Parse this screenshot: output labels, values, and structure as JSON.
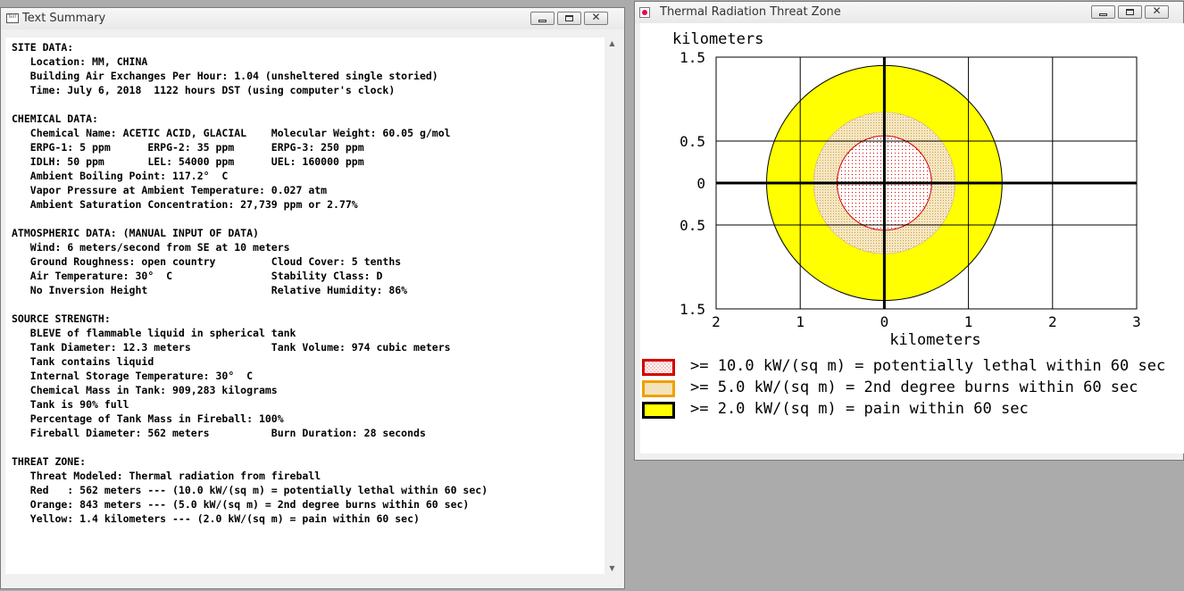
{
  "text_window": {
    "title": "Text Summary",
    "icon_text": "TEXT",
    "lines": [
      "SITE DATA:",
      "   Location: MM, CHINA",
      "   Building Air Exchanges Per Hour: 1.04 (unsheltered single storied)",
      "   Time: July 6, 2018  1122 hours DST (using computer's clock)",
      "",
      "CHEMICAL DATA:",
      "   Chemical Name: ACETIC ACID, GLACIAL    Molecular Weight: 60.05 g/mol",
      "   ERPG-1: 5 ppm      ERPG-2: 35 ppm      ERPG-3: 250 ppm",
      "   IDLH: 50 ppm       LEL: 54000 ppm      UEL: 160000 ppm",
      "   Ambient Boiling Point: 117.2°  C",
      "   Vapor Pressure at Ambient Temperature: 0.027 atm",
      "   Ambient Saturation Concentration: 27,739 ppm or 2.77%",
      "",
      "ATMOSPHERIC DATA: (MANUAL INPUT OF DATA)",
      "   Wind: 6 meters/second from SE at 10 meters",
      "   Ground Roughness: open country         Cloud Cover: 5 tenths",
      "   Air Temperature: 30°  C                Stability Class: D",
      "   No Inversion Height                    Relative Humidity: 86%",
      "",
      "SOURCE STRENGTH:",
      "   BLEVE of flammable liquid in spherical tank",
      "   Tank Diameter: 12.3 meters             Tank Volume: 974 cubic meters",
      "   Tank contains liquid",
      "   Internal Storage Temperature: 30°  C",
      "   Chemical Mass in Tank: 909,283 kilograms",
      "   Tank is 90% full",
      "   Percentage of Tank Mass in Fireball: 100%",
      "   Fireball Diameter: 562 meters          Burn Duration: 28 seconds",
      "",
      "THREAT ZONE:",
      "   Threat Modeled: Thermal radiation from fireball",
      "   Red   : 562 meters --- (10.0 kW/(sq m) = potentially lethal within 60 sec)",
      "   Orange: 843 meters --- (5.0 kW/(sq m) = 2nd degree burns within 60 sec)",
      "   Yellow: 1.4 kilometers --- (2.0 kW/(sq m) = pain within 60 sec)"
    ]
  },
  "threat_window": {
    "title": "Thermal Radiation Threat Zone",
    "colors": {
      "red": "#d40000",
      "orange": "#f0d9a6",
      "yellow": "#ffff00"
    },
    "legend": [
      {
        "label": ">= 10.0 kW/(sq m) = potentially lethal within 60 sec",
        "color": "red"
      },
      {
        "label": ">= 5.0 kW/(sq m) = 2nd degree burns within 60 sec",
        "color": "orange"
      },
      {
        "label": ">= 2.0 kW/(sq m) = pain within 60 sec",
        "color": "yellow"
      }
    ]
  },
  "chart_data": {
    "type": "threat-zone",
    "ylabel": "kilometers",
    "xlabel": "kilometers",
    "xlim": [
      -2,
      3
    ],
    "ylim": [
      -1.5,
      1.5
    ],
    "x_ticks": [
      -2,
      -1,
      0,
      1,
      2,
      3
    ],
    "x_tick_labels": [
      "2",
      "1",
      "0",
      "1",
      "2",
      "3"
    ],
    "y_ticks": [
      1.5,
      0.5,
      0,
      -0.5,
      -1.5
    ],
    "y_tick_labels": [
      "1.5",
      "0.5",
      "0",
      "0.5",
      "1.5"
    ],
    "grid": true,
    "zones": [
      {
        "name": "Yellow",
        "radius_km": 1.4,
        "fill": "yellow"
      },
      {
        "name": "Orange",
        "radius_km": 0.843,
        "fill": "orange"
      },
      {
        "name": "Red",
        "radius_km": 0.562,
        "fill": "red"
      }
    ]
  }
}
